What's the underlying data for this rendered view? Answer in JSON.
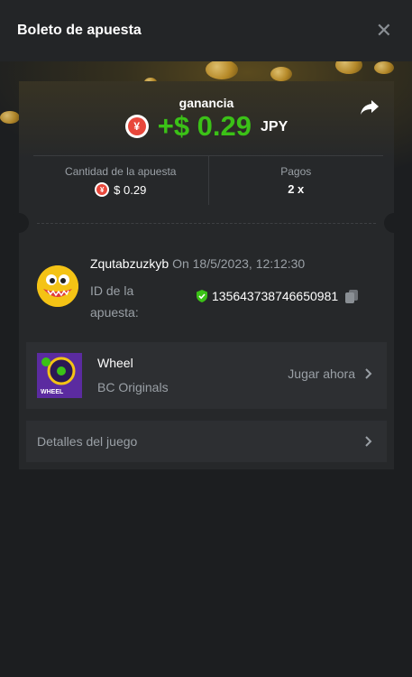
{
  "header": {
    "title": "Boleto de apuesta",
    "close_icon": "close-icon"
  },
  "profit": {
    "label": "ganancia",
    "currency_icon_symbol": "¥",
    "amount": "+$ 0.29",
    "currency": "JPY",
    "amount_color": "#3bc117"
  },
  "stats": {
    "bet_amount_label": "Cantidad de la apuesta",
    "bet_amount_value": "$ 0.29",
    "payout_label": "Pagos",
    "payout_value": "2 x"
  },
  "bet": {
    "username": "Zqutabzuzkyb",
    "datetime": "On 18/5/2023, 12:12:30",
    "id_label": "ID de la apuesta:",
    "id_value": "135643738746650981"
  },
  "game": {
    "name": "Wheel",
    "provider": "BC Originals",
    "thumb_text": "WHEEL",
    "play_label": "Jugar ahora"
  },
  "details": {
    "label": "Detalles del juego"
  }
}
